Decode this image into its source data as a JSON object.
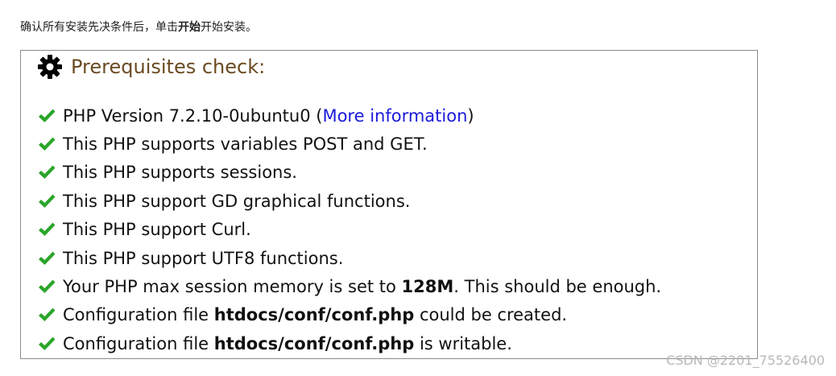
{
  "intro": {
    "before": "确认所有安装先决条件后，单击",
    "bold": "开始",
    "after": "开始安装。"
  },
  "panel": {
    "title": "Prerequisites check:",
    "icon": "gear-icon"
  },
  "checks": [
    {
      "pre": "PHP Version 7.2.10-0ubuntu0 (",
      "link": "More information",
      "post": ")"
    },
    {
      "text": "This PHP supports variables POST and GET."
    },
    {
      "text": "This PHP supports sessions."
    },
    {
      "text": "This PHP support GD graphical functions."
    },
    {
      "text": "This PHP support Curl."
    },
    {
      "text": "This PHP support UTF8 functions."
    },
    {
      "pre": "Your PHP max session memory is set to ",
      "bold": "128M",
      "post": ". This should be enough."
    },
    {
      "pre": "Configuration file ",
      "bold": "htdocs/conf/conf.php",
      "post": " could be created."
    },
    {
      "pre": "Configuration file ",
      "bold": "htdocs/conf/conf.php",
      "post": " is writable."
    }
  ],
  "colors": {
    "check": "#2aa52a",
    "title": "#6b4a22",
    "link": "#1a1adc"
  },
  "watermark": "CSDN @2201_75526400"
}
